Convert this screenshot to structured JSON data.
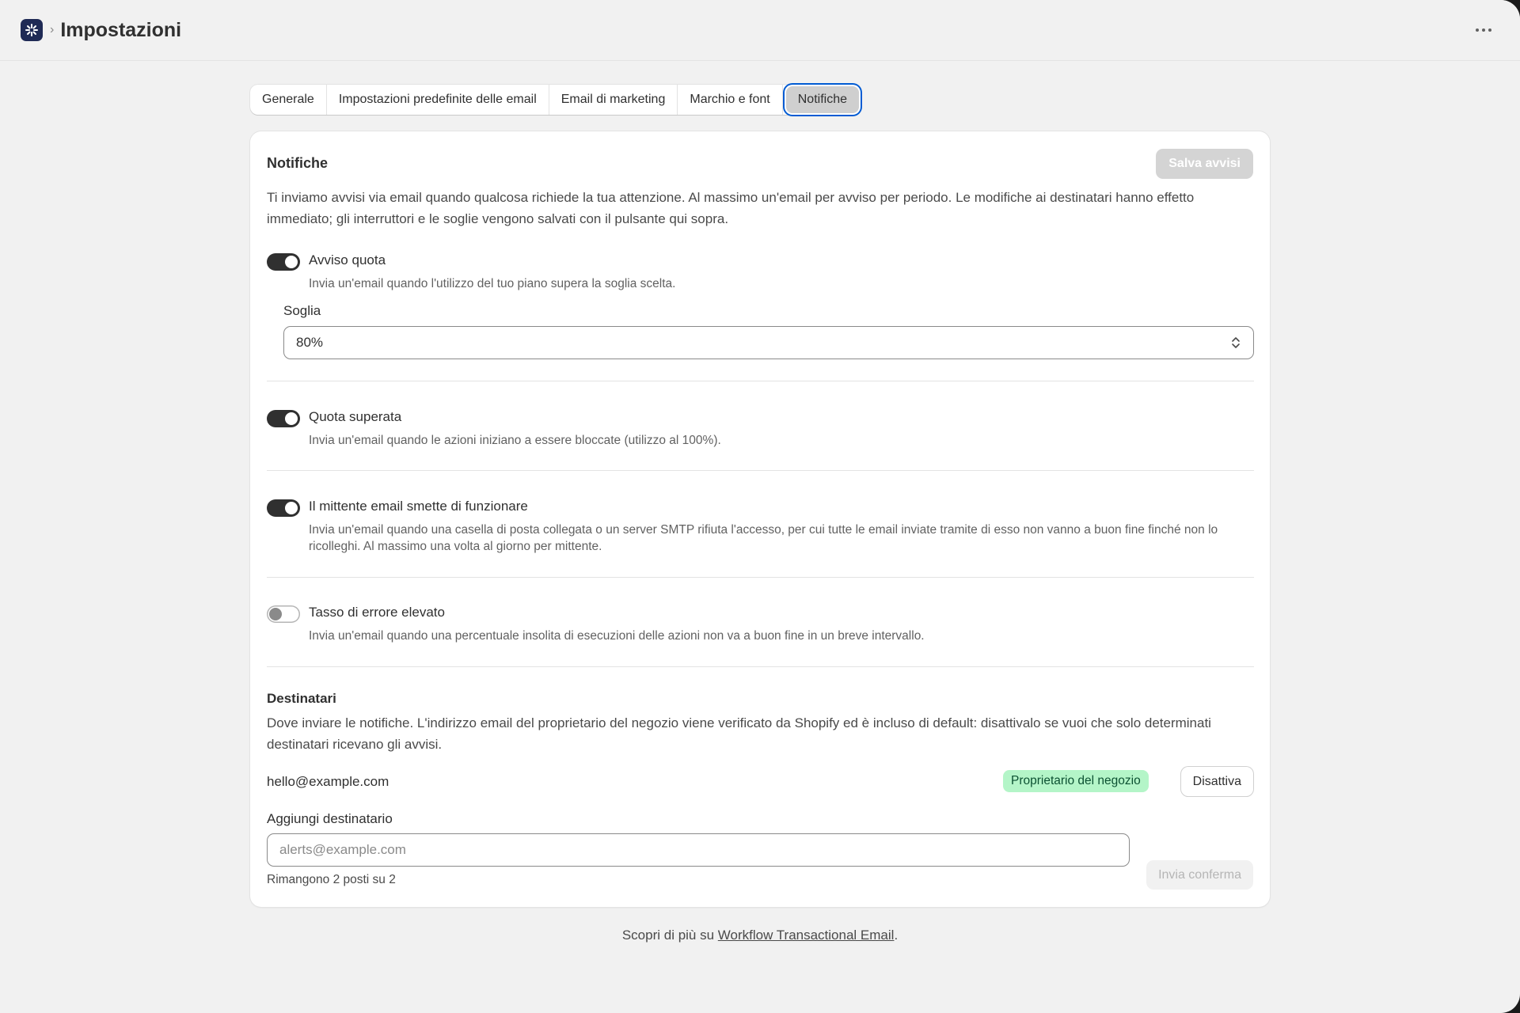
{
  "header": {
    "title": "Impostazioni",
    "breadcrumb_separator": "›",
    "logo_icon": "app-logo-icon",
    "more_icon": "ellipsis-icon"
  },
  "tabs": [
    {
      "label": "Generale",
      "active": false
    },
    {
      "label": "Impostazioni predefinite delle email",
      "active": false
    },
    {
      "label": "Email di marketing",
      "active": false
    },
    {
      "label": "Marchio e font",
      "active": false
    },
    {
      "label": "Notifiche",
      "active": true
    }
  ],
  "card": {
    "title": "Notifiche",
    "save_label": "Salva avvisi",
    "intro": "Ti inviamo avvisi via email quando qualcosa richiede la tua attenzione. Al massimo un'email per avviso per periodo. Le modifiche ai destinatari hanno effetto immediato; gli interruttori e le soglie vengono salvati con il pulsante qui sopra."
  },
  "settings": [
    {
      "label": "Avviso quota",
      "desc": "Invia un'email quando l'utilizzo del tuo piano supera la soglia scelta.",
      "enabled": true
    },
    {
      "label": "Quota superata",
      "desc": "Invia un'email quando le azioni iniziano a essere bloccate (utilizzo al 100%).",
      "enabled": true
    },
    {
      "label": "Il mittente email smette di funzionare",
      "desc": "Invia un'email quando una casella di posta collegata o un server SMTP rifiuta l'accesso, per cui tutte le email inviate tramite di esso non vanno a buon fine finché non lo ricolleghi. Al massimo una volta al giorno per mittente.",
      "enabled": true
    },
    {
      "label": "Tasso di errore elevato",
      "desc": "Invia un'email quando una percentuale insolita di esecuzioni delle azioni non va a buon fine in un breve intervallo.",
      "enabled": false
    }
  ],
  "threshold": {
    "label": "Soglia",
    "value": "80%"
  },
  "recipients": {
    "title": "Destinatari",
    "desc": "Dove inviare le notifiche. L'indirizzo email del proprietario del negozio viene verificato da Shopify ed è incluso di default: disattivalo se vuoi che solo determinati destinatari ricevano gli avvisi.",
    "email": "hello@example.com",
    "badge": "Proprietario del negozio",
    "deactivate_label": "Disattiva",
    "add_label": "Aggiungi destinatario",
    "add_placeholder": "alerts@example.com",
    "remaining": "Rimangono 2 posti su 2",
    "send_label": "Invia conferma"
  },
  "footer": {
    "prefix": "Scopri di più su ",
    "link": "Workflow Transactional Email",
    "suffix": "."
  },
  "colors": {
    "accent_focus": "#005bd3",
    "badge_bg": "#b4f5c8",
    "badge_text": "#0c5132",
    "toggle_on": "#303030"
  }
}
